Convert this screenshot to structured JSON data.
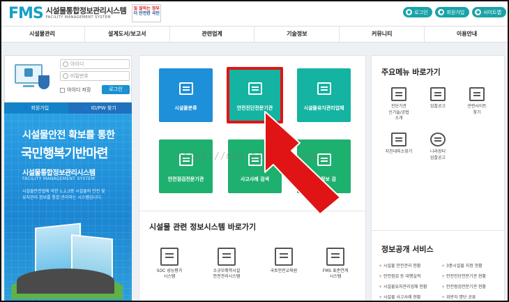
{
  "header": {
    "logo_mark": "FMS",
    "logo_kor": "시설물통합정보관리시스템",
    "logo_eng": "FACILITY MANAGEMENT SYSTEM",
    "slogan_line1": "일 잘하는 정부",
    "slogan_line2": "더 안전한 국민",
    "buttons": [
      "로그인",
      "회원가입",
      "사이트맵"
    ]
  },
  "nav": [
    "시설물관리",
    "설계도서/보고서",
    "관련업계",
    "기술정보",
    "커뮤니티",
    "이용안내"
  ],
  "login": {
    "id_placeholder": "아이디",
    "pw_placeholder": "비밀번호",
    "save_id": "아이디 저장",
    "login_button": "로그인",
    "tab_join": "회원가입",
    "tab_find": "ID/PW 찾기"
  },
  "banner": {
    "line1": "시설물안전 확보를 통한",
    "line2": "국민행복기반마련",
    "line3": "시설물통합정보관리시스템",
    "line4": "FACILITY MANAGEMENT SYSTEM",
    "desc1": "시설물안전법에 의한 1,2,3종 시설물의 안전 및",
    "desc2": "유지관리 정보를 통합 관리하는 시스템입니다."
  },
  "tiles": [
    {
      "label": "시설물분류"
    },
    {
      "label": "안전진단전문기관"
    },
    {
      "label": "시설물유지관리업체"
    },
    {
      "label": "안전점검전문기관"
    },
    {
      "label": "사고사례 검색"
    },
    {
      "label": "기술정보 검"
    }
  ],
  "watermark": "https://moo.tistory.com",
  "systems": {
    "title": "시설물 관련 정보시스템 바로가기",
    "items": [
      {
        "line1": "SOC 성능평가",
        "line2": "시스템"
      },
      {
        "line1": "소규모취약시설",
        "line2": "안전관리시스템"
      },
      {
        "line1": "국토안전교육원",
        "line2": ""
      },
      {
        "line1": "FMS 표준연계",
        "line2": "시스템"
      }
    ]
  },
  "quick_menu": {
    "title": "주요메뉴 바로가기",
    "items": [
      {
        "line1": "진단기관",
        "line2": "신기술/공법",
        "line3": "소개"
      },
      {
        "line1": "입찰공고",
        "line2": "",
        "line3": ""
      },
      {
        "line1": "관련사이트",
        "line2": "찾기",
        "line3": ""
      },
      {
        "line1": "지진대피소찾기",
        "line2": "",
        "line3": ""
      },
      {
        "line1": "나라장터",
        "line2": "입찰공고",
        "line3": ""
      }
    ]
  },
  "public_service": {
    "title": "정보공개 서비스",
    "items": [
      "시설물 안전관리 현황",
      "3종시설물 지정 현황",
      "안전점검 등 대행실적",
      "안전진단전문기관 현황",
      "시설물유지관리업체 현황",
      "안전점검전문기관 현황",
      "시설물 사고사례 현황",
      "위반자 명단 공표"
    ]
  },
  "colors": {
    "accent": "#1e8fd9",
    "highlight": "#e21313",
    "header_button": "#19a3a8"
  }
}
